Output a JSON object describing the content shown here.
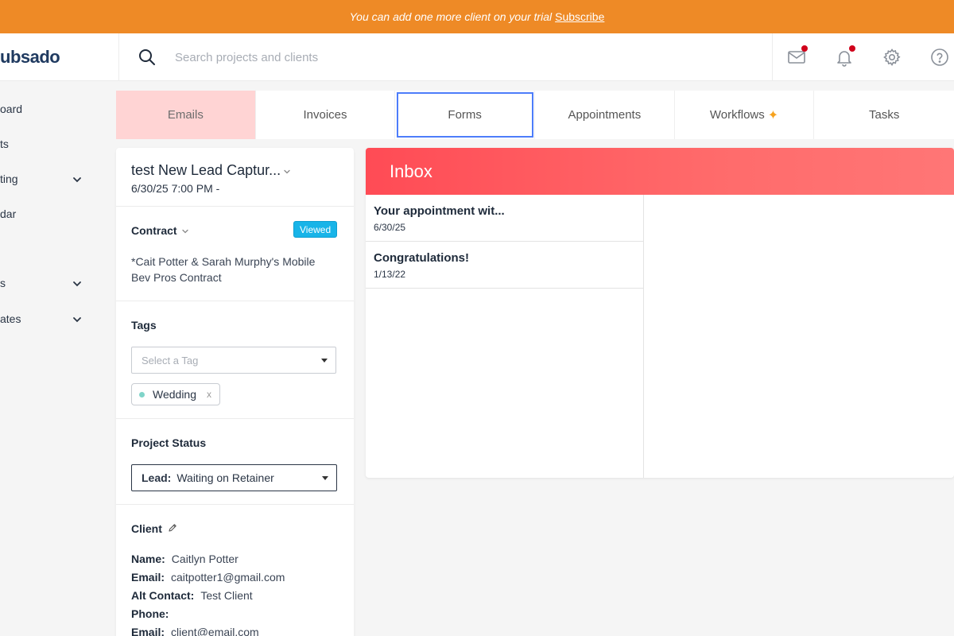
{
  "banner": {
    "text": "You can add one more client on your trial",
    "link": "Subscribe"
  },
  "header": {
    "logo": "ubsado",
    "search_placeholder": "Search projects and clients",
    "icons": [
      "mail-icon",
      "bell-icon",
      "gear-icon",
      "help-icon"
    ]
  },
  "sidebar": {
    "items": [
      {
        "label": "oard",
        "chevron": false
      },
      {
        "label": "ts",
        "chevron": false
      },
      {
        "label": "ting",
        "chevron": true
      },
      {
        "label": "dar",
        "chevron": false
      },
      {
        "label": "s",
        "chevron": true
      },
      {
        "label": "ates",
        "chevron": true
      }
    ]
  },
  "tabs": [
    {
      "label": "Emails",
      "active": true
    },
    {
      "label": "Invoices"
    },
    {
      "label": "Forms",
      "focused": true
    },
    {
      "label": "Appointments"
    },
    {
      "label": "Workflows"
    },
    {
      "label": "Tasks"
    }
  ],
  "project": {
    "title": "test New Lead Captur...",
    "date": "6/30/25 7:00 PM -"
  },
  "contract": {
    "label": "Contract",
    "badge": "Viewed",
    "name_line1": "*Cait Potter & Sarah Murphy's Mobile",
    "name_line2": "Bev Pros Contract"
  },
  "tags": {
    "label": "Tags",
    "placeholder": "Select a Tag",
    "chips": [
      {
        "label": "Wedding",
        "color": "#7fd4c9"
      }
    ]
  },
  "project_status": {
    "label": "Project Status",
    "stage": "Lead:",
    "value": "Waiting on Retainer"
  },
  "client": {
    "label": "Client",
    "fields": [
      {
        "label": "Name:",
        "value": "Caitlyn Potter"
      },
      {
        "label": "Email:",
        "value": "caitpotter1@gmail.com"
      },
      {
        "label": "Alt Contact:",
        "value": "Test Client"
      },
      {
        "label": "Phone:",
        "value": ""
      },
      {
        "label": "Email:",
        "value": "client@email.com"
      }
    ]
  },
  "inbox": {
    "title": "Inbox",
    "messages": [
      {
        "title": "Your appointment wit...",
        "date": "6/30/25"
      },
      {
        "title": "Congratulations!",
        "date": "1/13/22"
      }
    ]
  },
  "colors": {
    "banner": "#ee8a26",
    "accent": "#ff4b55",
    "active_tab": "#ffd4d4",
    "focus": "#4d7dfa",
    "badge": "#18b4e8",
    "notification": "#d0021b"
  }
}
